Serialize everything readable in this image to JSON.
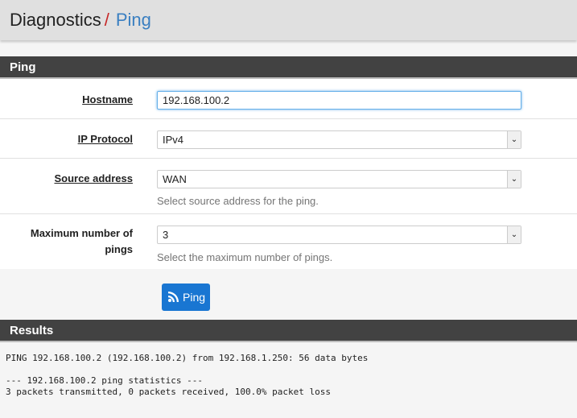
{
  "header": {
    "section": "Diagnostics",
    "separator": "/",
    "current": "Ping"
  },
  "panel": {
    "title": "Ping"
  },
  "form": {
    "hostname": {
      "label": "Hostname",
      "value": "192.168.100.2"
    },
    "ip_protocol": {
      "label": "IP Protocol",
      "value": "IPv4"
    },
    "source": {
      "label": "Source address",
      "value": "WAN",
      "help": "Select source address for the ping."
    },
    "count": {
      "label": "Maximum number of pings",
      "value": "3",
      "help": "Select the maximum number of pings."
    }
  },
  "button": {
    "label": "Ping",
    "icon": "rss-icon"
  },
  "results": {
    "title": "Results",
    "output": "PING 192.168.100.2 (192.168.100.2) from 192.168.1.250: 56 data bytes\n\n--- 192.168.100.2 ping statistics ---\n3 packets transmitted, 0 packets received, 100.0% packet loss"
  }
}
